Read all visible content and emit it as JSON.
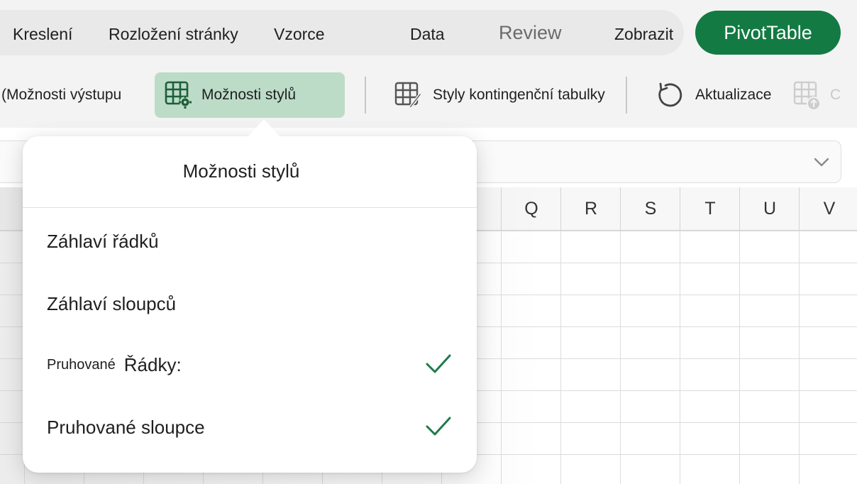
{
  "tabs": {
    "kresleni": "Kreslení",
    "rozlozeni": "Rozložení stránky",
    "vzorce": "Vzorce",
    "data": "Data",
    "review": "Review",
    "zobrazit": "Zobrazit",
    "pivot": "PivotTable"
  },
  "ribbon": {
    "moznosti_vystupu": "(Možnosti výstupu",
    "moznosti_stylu": "Možnosti stylů",
    "styly": "Styly kontingenční tabulky",
    "aktualizace": "Aktualizace",
    "truncated": "C"
  },
  "columns": [
    "Q",
    "R",
    "S",
    "T",
    "U",
    "V"
  ],
  "popover": {
    "title": "Možnosti stylů",
    "options": [
      {
        "label": "Záhlaví řádků",
        "checked": false
      },
      {
        "label": "Záhlaví sloupců",
        "checked": false
      },
      {
        "prefix": "Pruhované",
        "label": "Řádky:",
        "checked": true
      },
      {
        "label": "Pruhované sloupce",
        "checked": true
      }
    ]
  },
  "colors": {
    "accent": "#137a43",
    "active_button_bg": "#bcdcc8",
    "check": "#1f7a4c"
  },
  "icons": {
    "style_options": "table-gear-icon",
    "pivot_styles": "table-brush-icon",
    "refresh": "refresh-icon",
    "change_source": "table-upload-icon",
    "dropdown": "chevron-down-icon",
    "check": "checkmark-icon"
  }
}
